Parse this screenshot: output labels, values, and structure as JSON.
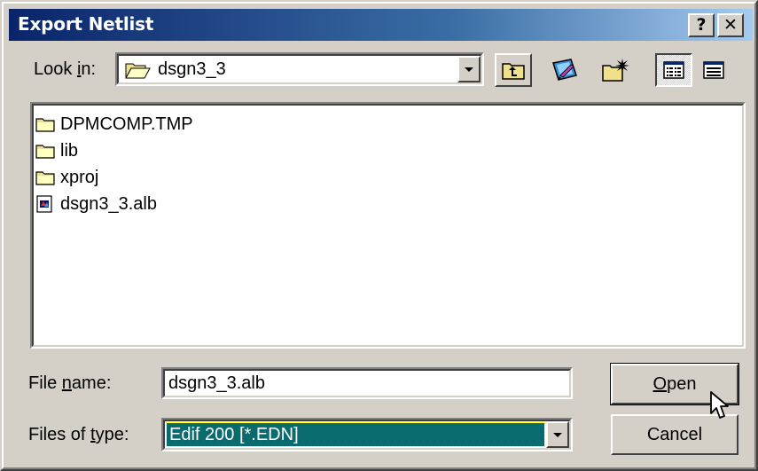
{
  "window": {
    "title": "Export Netlist",
    "help_label": "?",
    "close_label": "✕"
  },
  "look_in": {
    "label_before": "Look ",
    "label_mnemonic": "i",
    "label_after": "n:",
    "value": "dsgn3_3"
  },
  "toolbar": {
    "buttons": [
      "up-one-level",
      "desktop",
      "create-new-folder",
      "list-view",
      "details-view"
    ]
  },
  "files": [
    {
      "name": "DPMCOMP.TMP",
      "icon": "folder-icon"
    },
    {
      "name": "lib",
      "icon": "folder-icon"
    },
    {
      "name": "xproj",
      "icon": "folder-icon"
    },
    {
      "name": "dsgn3_3.alb",
      "icon": "alb-file-icon"
    }
  ],
  "file_name": {
    "label_before": "File ",
    "label_mnemonic": "n",
    "label_after": "ame:",
    "value": "dsgn3_3.alb"
  },
  "file_type": {
    "label_before": "Files of ",
    "label_mnemonic": "t",
    "label_after": "ype:",
    "value": "Edif 200 [*.EDN]"
  },
  "buttons": {
    "open_mnemonic": "O",
    "open_rest": "pen",
    "cancel": "Cancel"
  },
  "colors": {
    "titlebar_start": "#0a246a",
    "titlebar_end": "#a6caf0",
    "selection": "#0a6b6e",
    "face": "#d4d0c8"
  }
}
